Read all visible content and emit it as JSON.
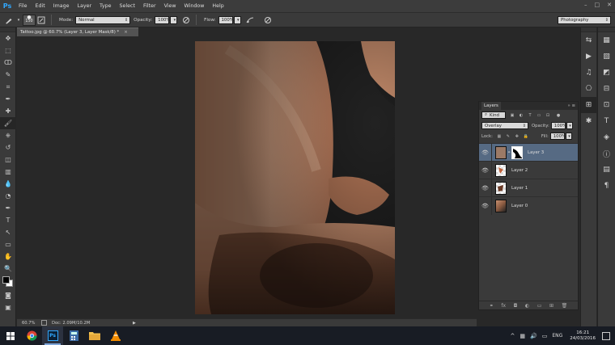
{
  "app": {
    "logo": "Ps"
  },
  "menu": [
    "File",
    "Edit",
    "Image",
    "Layer",
    "Type",
    "Select",
    "Filter",
    "View",
    "Window",
    "Help"
  ],
  "window_controls": [
    "–",
    "□",
    "✕"
  ],
  "options": {
    "brush_size": "150",
    "mode_label": "Mode:",
    "mode_value": "Normal",
    "opacity_label": "Opacity:",
    "opacity_value": "100%",
    "flow_label": "Flow:",
    "flow_value": "100%",
    "workspace": "Photography"
  },
  "document": {
    "tab_title": "Tattoo.jpg @ 60.7% (Layer 3, Layer Mask/8) *",
    "close": "×"
  },
  "status": {
    "zoom": "60.7%",
    "doc_size": "Doc: 2.09M/10.2M",
    "arrow": "▶"
  },
  "layers_panel": {
    "title": "Layers",
    "kind_label": "Kind",
    "blend_mode": "Overlay",
    "opacity_label": "Opacity:",
    "opacity_value": "100%",
    "lock_label": "Lock:",
    "fill_label": "Fill:",
    "fill_value": "100%",
    "layers": [
      {
        "name": "Layer 3",
        "selected": true,
        "has_mask": true
      },
      {
        "name": "Layer 2",
        "selected": false,
        "has_mask": false
      },
      {
        "name": "Layer 1",
        "selected": false,
        "has_mask": false
      },
      {
        "name": "Layer 0",
        "selected": false,
        "has_mask": false
      }
    ],
    "footer_icons": [
      "link-icon",
      "fx-icon",
      "mask-icon",
      "adjustment-icon",
      "group-icon",
      "new-layer-icon",
      "trash-icon"
    ],
    "footer_labels": [
      "⚭",
      "fx",
      "◘",
      "◐",
      "▭",
      "⊞",
      "🗑"
    ]
  },
  "tools": [
    "move-tool",
    "marquee-tool",
    "lasso-tool",
    "quick-select-tool",
    "crop-tool",
    "eyedropper-tool",
    "healing-tool",
    "brush-tool",
    "clone-stamp-tool",
    "history-brush-tool",
    "eraser-tool",
    "gradient-tool",
    "blur-tool",
    "dodge-tool",
    "pen-tool",
    "type-tool",
    "path-select-tool",
    "shape-tool",
    "hand-tool",
    "zoom-tool"
  ],
  "tool_glyphs": [
    "✥",
    "⬚",
    "ↀ",
    "✎",
    "⌗",
    "✒",
    "✚",
    "🖌",
    "⎈",
    "↺",
    "◫",
    "▥",
    "💧",
    "◔",
    "✒",
    "T",
    "↖",
    "▭",
    "✋",
    "🔍"
  ],
  "dock1_glyphs": [
    "⇆",
    "▶",
    "♫",
    "⎔",
    "⊞",
    "✱"
  ],
  "dock2_glyphs": [
    "▦",
    "▧",
    "◩",
    "⊟",
    "⊡",
    "T",
    "◈",
    "ⓘ",
    "▤",
    "¶"
  ],
  "taskbar": {
    "apps": [
      "start-icon",
      "chrome-icon",
      "photoshop-icon",
      "calculator-icon",
      "file-explorer-icon",
      "vlc-icon"
    ],
    "tray": {
      "lang": "ENG",
      "time": "16:21",
      "date": "24/03/2016"
    }
  }
}
